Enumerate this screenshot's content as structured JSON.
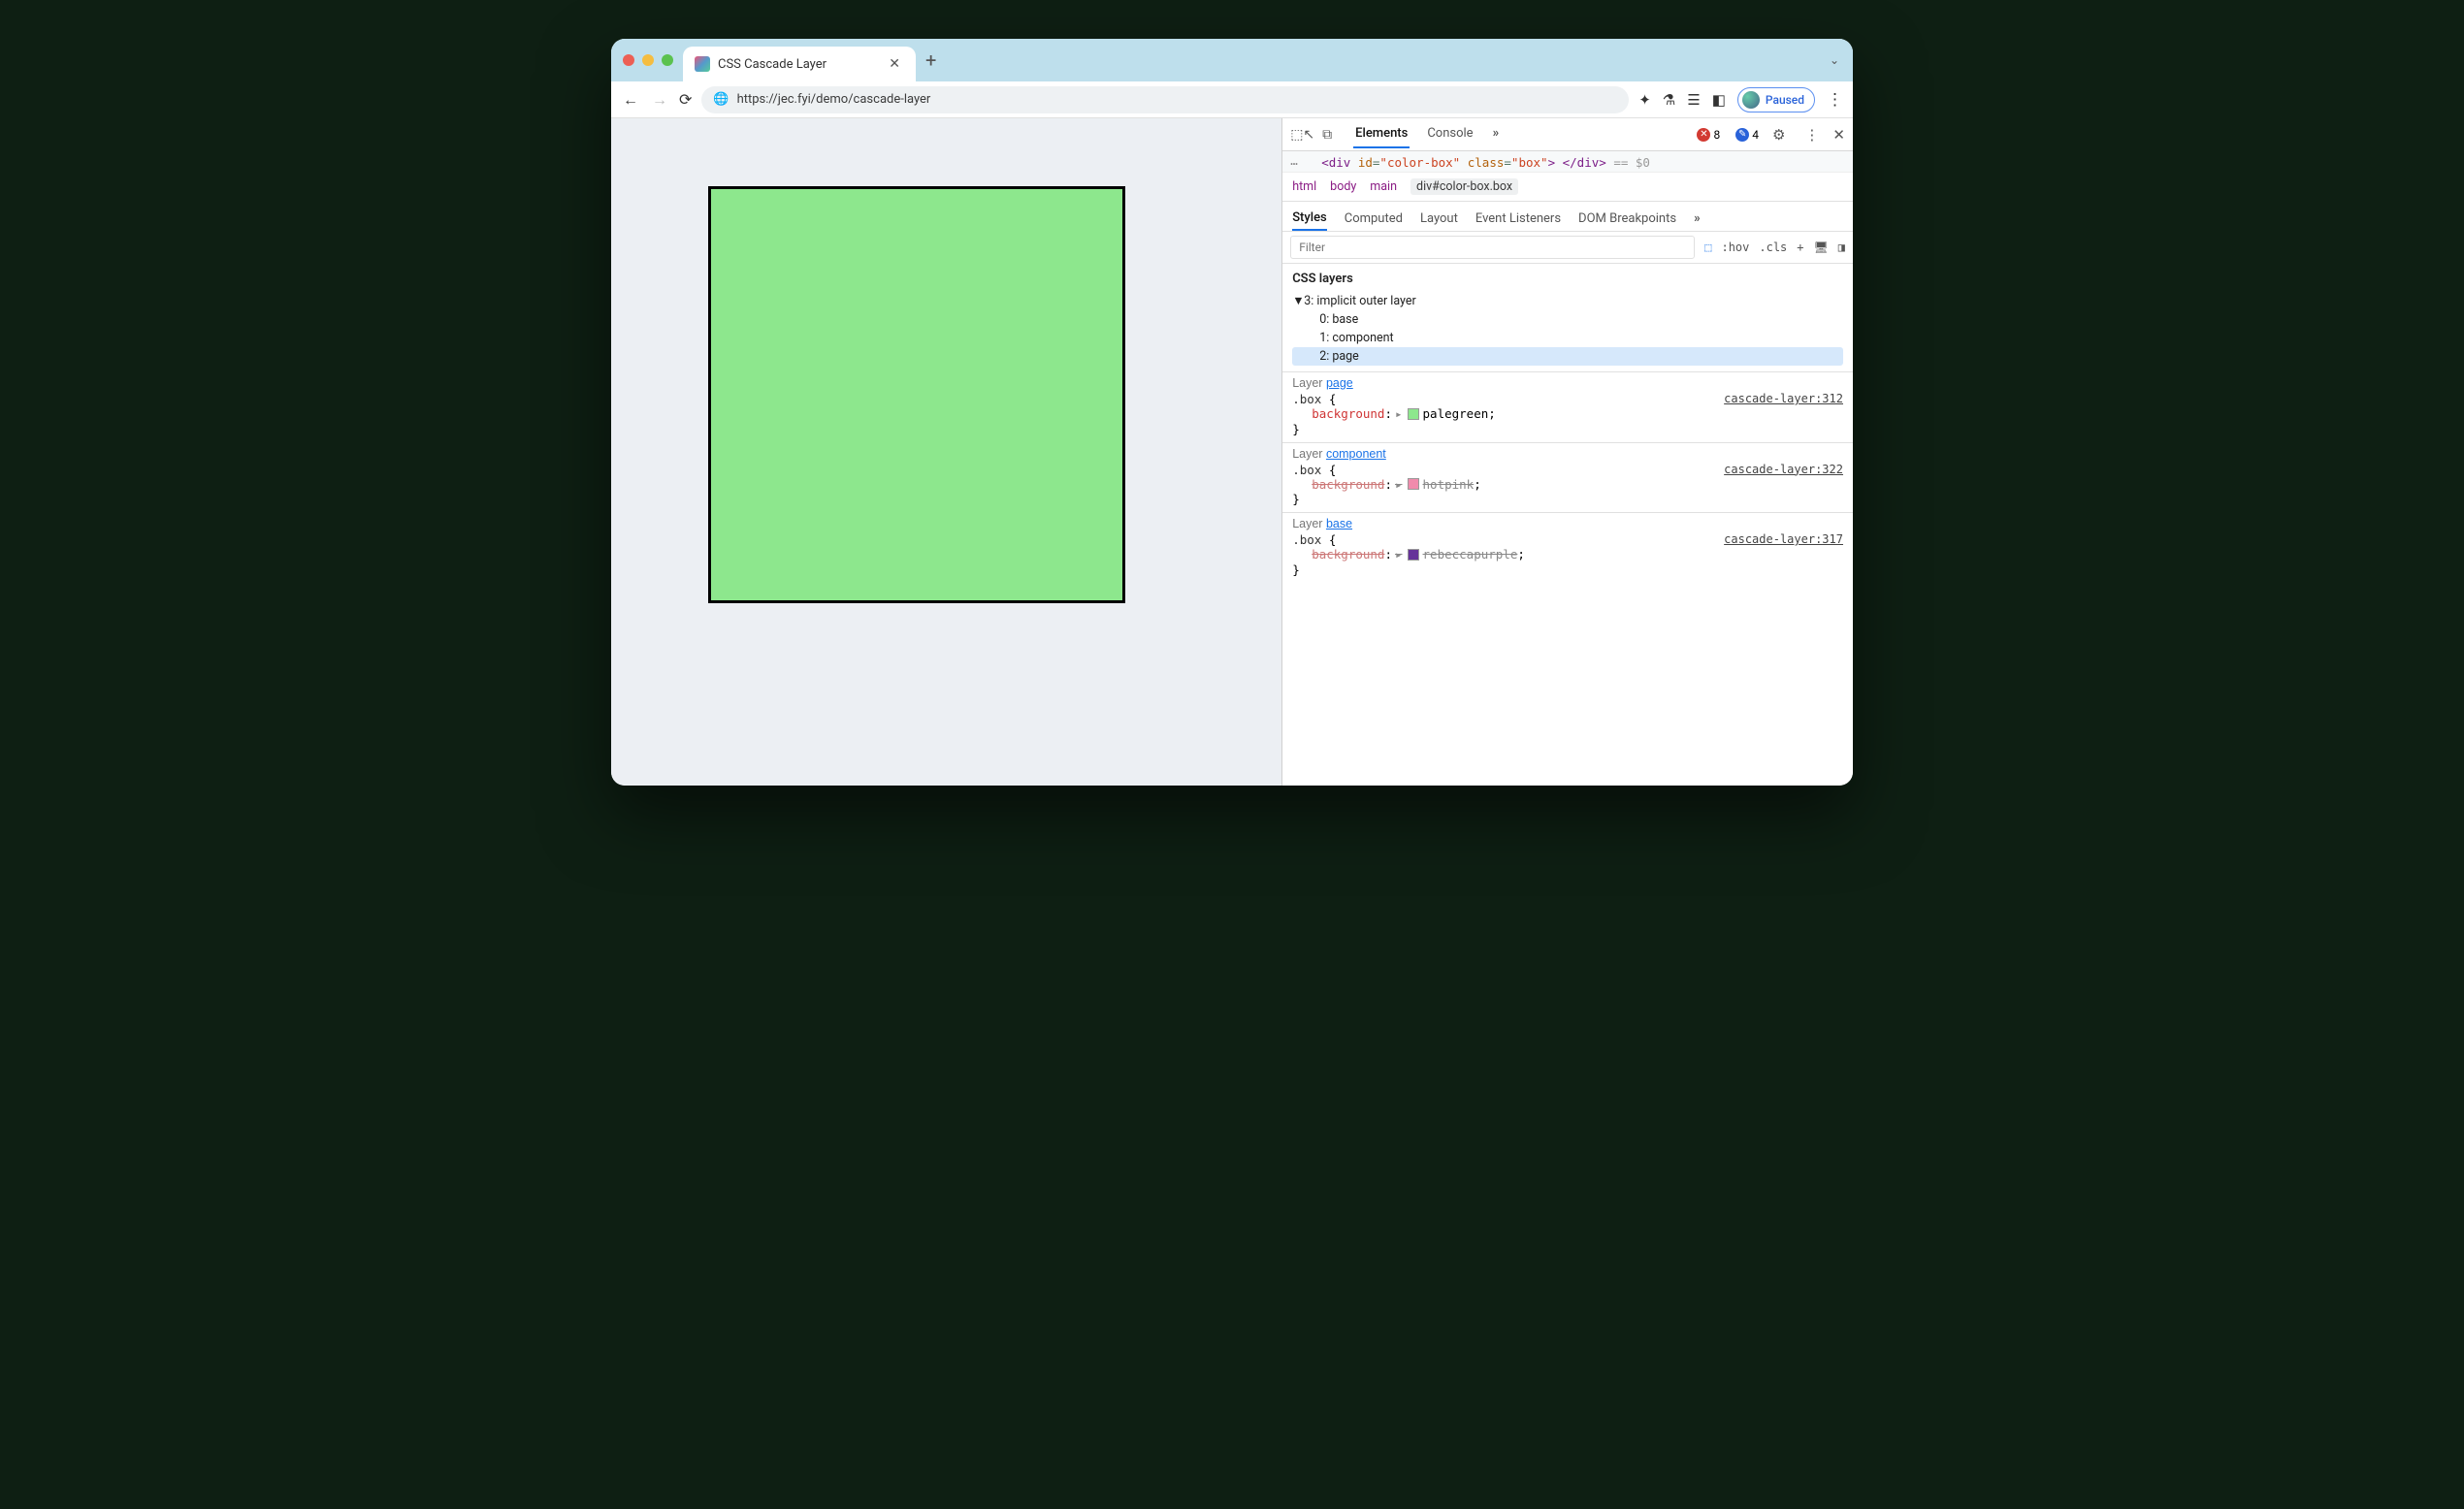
{
  "tab": {
    "title": "CSS Cascade Layer"
  },
  "address": {
    "url": "https://jec.fyi/demo/cascade-layer"
  },
  "profile": {
    "label": "Paused"
  },
  "devtools": {
    "panels": {
      "elements": "Elements",
      "console": "Console",
      "more": "»"
    },
    "errors": 8,
    "messages": 4,
    "selected_element": "<div id=\"color-box\" class=\"box\"> </div>",
    "selected_suffix": "== $0",
    "breadcrumbs": [
      "html",
      "body",
      "main",
      "div#color-box.box"
    ],
    "styles_tabs": {
      "styles": "Styles",
      "computed": "Computed",
      "layout": "Layout",
      "events": "Event Listeners",
      "dom": "DOM Breakpoints",
      "more": "»"
    },
    "filter_placeholder": "Filter",
    "tools": {
      "hov": ":hov",
      "cls": ".cls",
      "plus": "+"
    },
    "layers_title": "CSS layers",
    "layers": {
      "root": "3: implicit outer layer",
      "children": [
        "0: base",
        "1: component",
        "2: page"
      ]
    },
    "rules": [
      {
        "layer_label": "Layer ",
        "layer_link": "page",
        "selector": ".box",
        "source": "cascade-layer:312",
        "property": "background",
        "value": "palegreen",
        "swatch": "#8de78d",
        "struck": false
      },
      {
        "layer_label": "Layer ",
        "layer_link": "component",
        "selector": ".box",
        "source": "cascade-layer:322",
        "property": "background",
        "value": "hotpink",
        "swatch": "#f08bac",
        "struck": true
      },
      {
        "layer_label": "Layer ",
        "layer_link": "base",
        "selector": ".box",
        "source": "cascade-layer:317",
        "property": "background",
        "value": "rebeccapurple",
        "swatch": "#663399",
        "struck": true
      }
    ]
  }
}
